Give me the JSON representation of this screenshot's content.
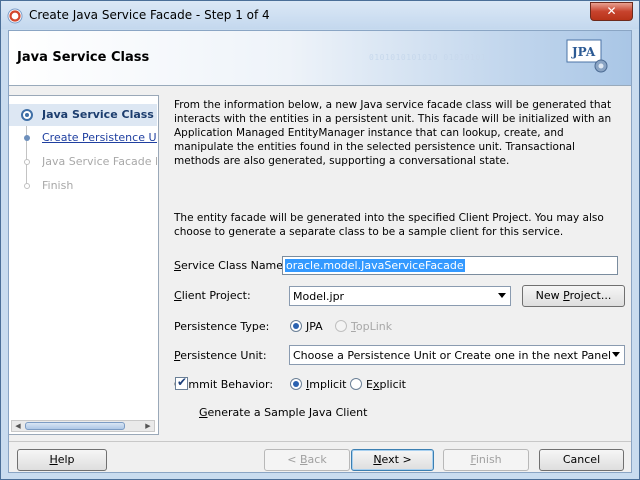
{
  "window": {
    "title": "Create Java Service Facade - Step 1 of 4",
    "close_glyph": "✕"
  },
  "header": {
    "title": "Java Service Class",
    "bits": "0101010101010 01010101",
    "logo_text": "JPA"
  },
  "train": {
    "steps": [
      {
        "label": "Java Service Class",
        "state": "current"
      },
      {
        "label": "Create Persistence Unit",
        "state": "link"
      },
      {
        "label": "Java Service Facade Me",
        "state": "disabled"
      },
      {
        "label": "Finish",
        "state": "disabled"
      }
    ],
    "scroll_left": "◀",
    "scroll_right": "▶"
  },
  "main": {
    "description": "From the information below, a new Java service facade class will be generated that interacts with the entities in a persistent unit.  This facade will be initialized with an Application Managed EntityManager instance that can lookup, create, and manipulate the entities found in the selected persistence unit.  Transactional methods are also generated, supporting a conversational state.",
    "description2": "The entity facade will be generated into the specified Client Project.  You may also choose to generate a separate class to be a sample client for this service.",
    "service_class_label_u": "S",
    "service_class_label_rest": "ervice Class Name:",
    "service_class_value": "oracle.model.JavaServiceFacade",
    "client_project_label_u": "C",
    "client_project_label_rest": "lient Project:",
    "client_project_value": "Model.jpr",
    "new_project_label_a": "New ",
    "new_project_label_u": "P",
    "new_project_label_b": "roject...",
    "persistence_type_label": "Persistence Type:",
    "persistence_type_options": [
      {
        "u": "J",
        "rest": "PA",
        "selected": true,
        "enabled": true
      },
      {
        "u": "T",
        "rest": "opLink",
        "selected": false,
        "enabled": false
      }
    ],
    "persistence_unit_label_u": "P",
    "persistence_unit_label_rest": "ersistence Unit:",
    "persistence_unit_value": "Choose a Persistence Unit or Create one in the next Panel",
    "commit_behavior_label": "Commit Behavior:",
    "commit_options": [
      {
        "u": "I",
        "rest": "mplicit",
        "selected": true
      },
      {
        "u": "x",
        "pre": "E",
        "rest": "plicit",
        "selected": false
      }
    ],
    "generate_client_u": "G",
    "generate_client_rest": "enerate a Sample Java Client",
    "generate_client_checked": true,
    "check_glyph": "✔"
  },
  "footer": {
    "help_u": "H",
    "help_rest": "elp",
    "back_pre": "< ",
    "back_u": "B",
    "back_rest": "ack",
    "next_u": "N",
    "next_rest": "ext >",
    "finish_u": "F",
    "finish_rest": "inish",
    "cancel": "Cancel"
  }
}
